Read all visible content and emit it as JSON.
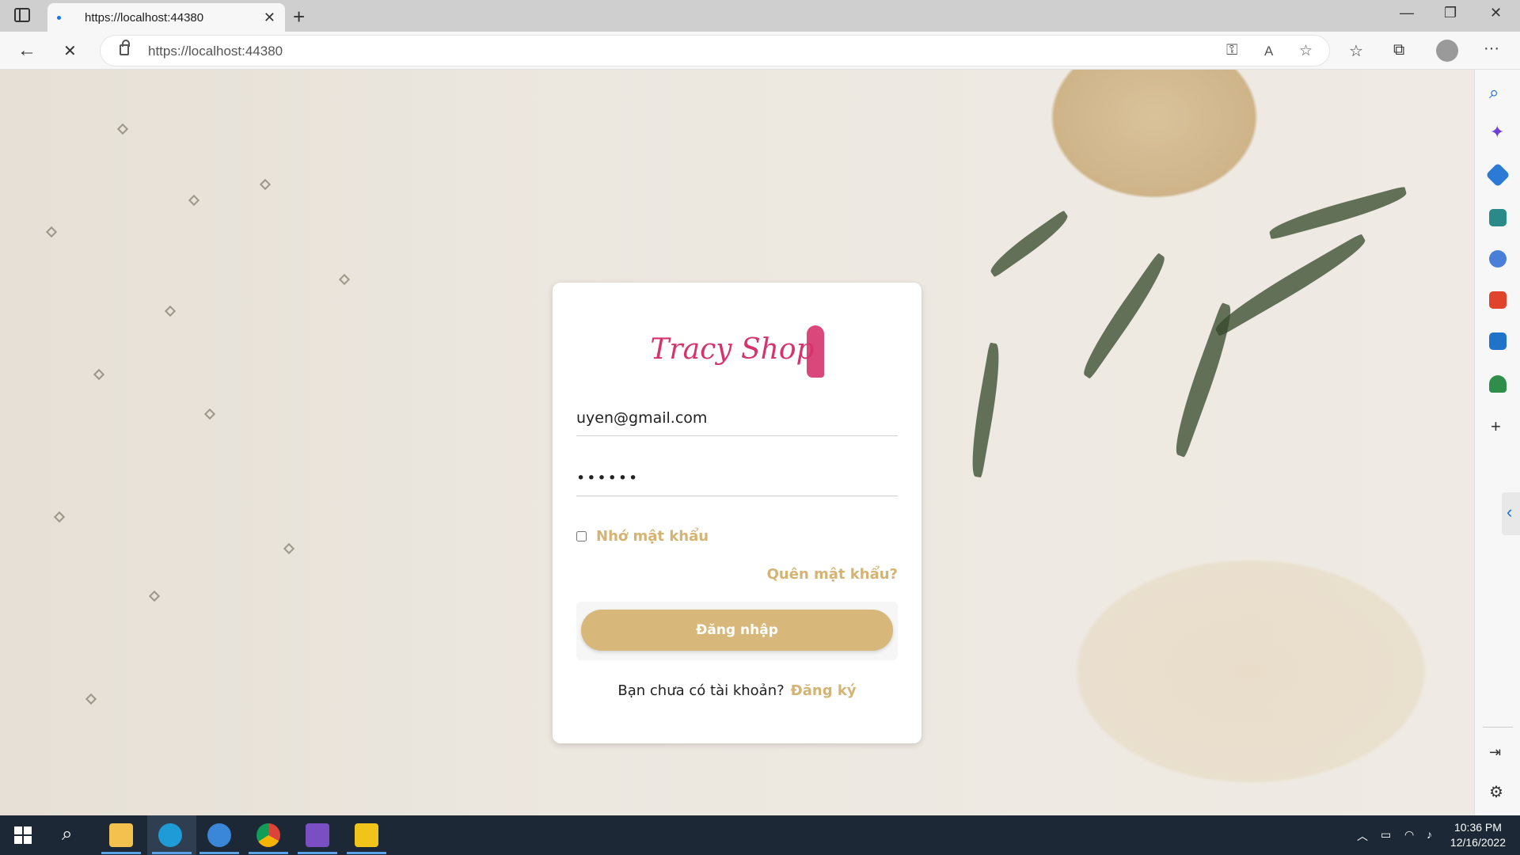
{
  "browser": {
    "tab_title": "https://localhost:44380",
    "new_tab_label": "+",
    "url": "https://localhost:44380",
    "minimize_label": "—",
    "maximize_label": "❐",
    "close_label": "✕",
    "tab_close_label": "✕",
    "back_label": "←",
    "stop_label": "✕",
    "more_label": "···"
  },
  "login": {
    "brand": "Tracy Shop",
    "email_value": "uyen@gmail.com",
    "password_value": "••••••",
    "remember_label": "Nhớ mật khẩu",
    "forgot_label": "Quên mật khẩu?",
    "login_button": "Đăng nhập",
    "no_account_text": "Bạn chưa có tài khoản?",
    "register_link": "Đăng ký"
  },
  "taskbar": {
    "time": "10:36 PM",
    "date": "12/16/2022"
  },
  "colors": {
    "accent": "#d7b87a",
    "brand": "#d6336c"
  }
}
